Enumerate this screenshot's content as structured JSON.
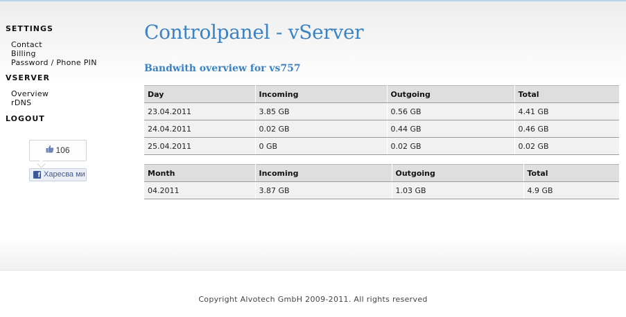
{
  "sidebar": {
    "settings_heading": "SETTINGS",
    "settings_items": [
      "Contact",
      "Billing",
      "Password / Phone PIN"
    ],
    "vserver_heading": "VSERVER",
    "vserver_items": [
      "Overview",
      "rDNS"
    ],
    "logout": "LOGOUT"
  },
  "like_widget": {
    "count": "106",
    "button_label": "Харесва ми",
    "brand_color": "#3b5998"
  },
  "main": {
    "title": "Controlpanel - vServer",
    "subtitle": "Bandwith overview for vs757",
    "accent_color": "#3b82c4",
    "daily_table": {
      "headers": [
        "Day",
        "Incoming",
        "Outgoing",
        "Total"
      ],
      "rows": [
        [
          "23.04.2011",
          "3.85 GB",
          "0.56 GB",
          "4.41 GB"
        ],
        [
          "24.04.2011",
          "0.02 GB",
          "0.44 GB",
          "0.46 GB"
        ],
        [
          "25.04.2011",
          "0 GB",
          "0.02 GB",
          "0.02 GB"
        ]
      ]
    },
    "monthly_table": {
      "headers": [
        "Month",
        "Incoming",
        "Outgoing",
        "Total"
      ],
      "rows": [
        [
          "04.2011",
          "3.87 GB",
          "1.03 GB",
          "4.9 GB"
        ]
      ]
    }
  },
  "footer": {
    "copyright": "Copyright Alvotech GmbH 2009-2011. All rights reserved"
  }
}
